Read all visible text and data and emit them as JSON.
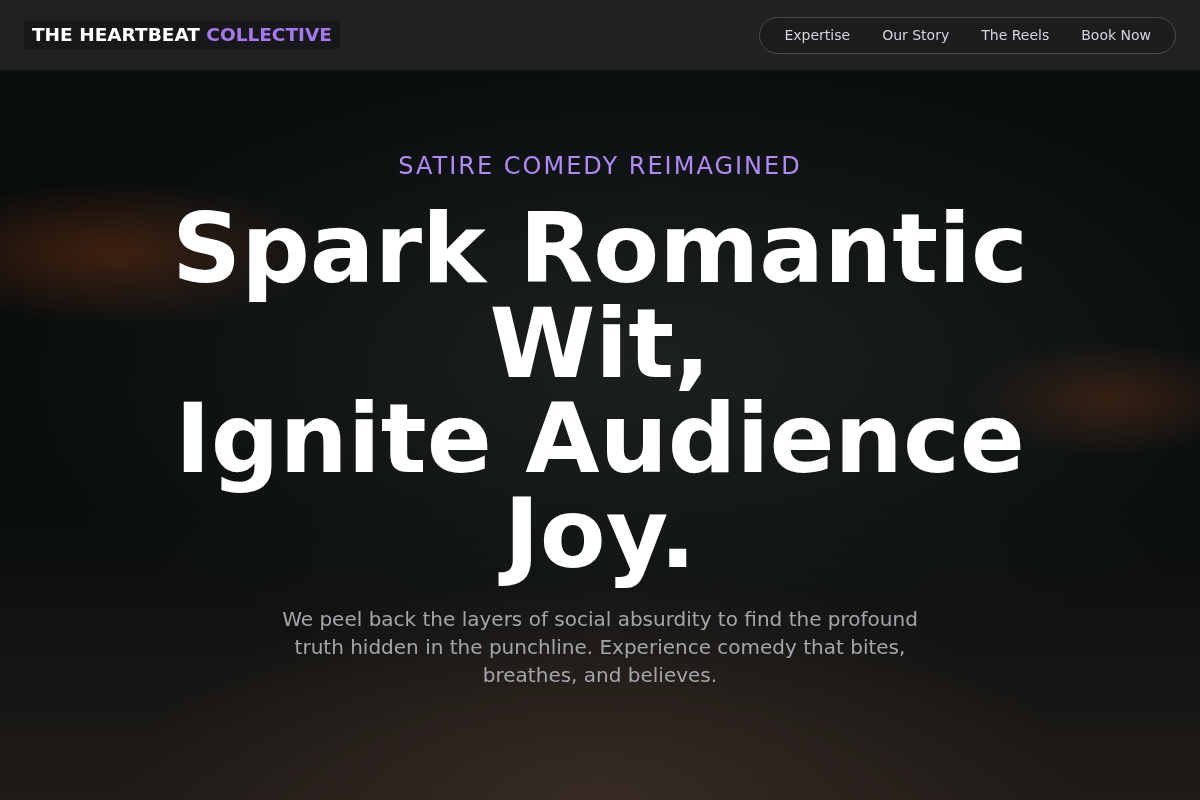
{
  "header": {
    "logo": {
      "text": "THE HEARTBEAT",
      "accent": "COLLECTIVE"
    },
    "nav": [
      "Expertise",
      "Our Story",
      "The Reels",
      "Book Now"
    ]
  },
  "hero": {
    "eyebrow": "SATIRE COMEDY REIMAGINED",
    "headline": [
      "Spark Romantic Wit,",
      "Ignite Audience Joy."
    ],
    "description": "We peel back the layers of social absurdity to find the profound truth hidden in the punchline. Experience comedy that bites, breathes, and believes."
  }
}
